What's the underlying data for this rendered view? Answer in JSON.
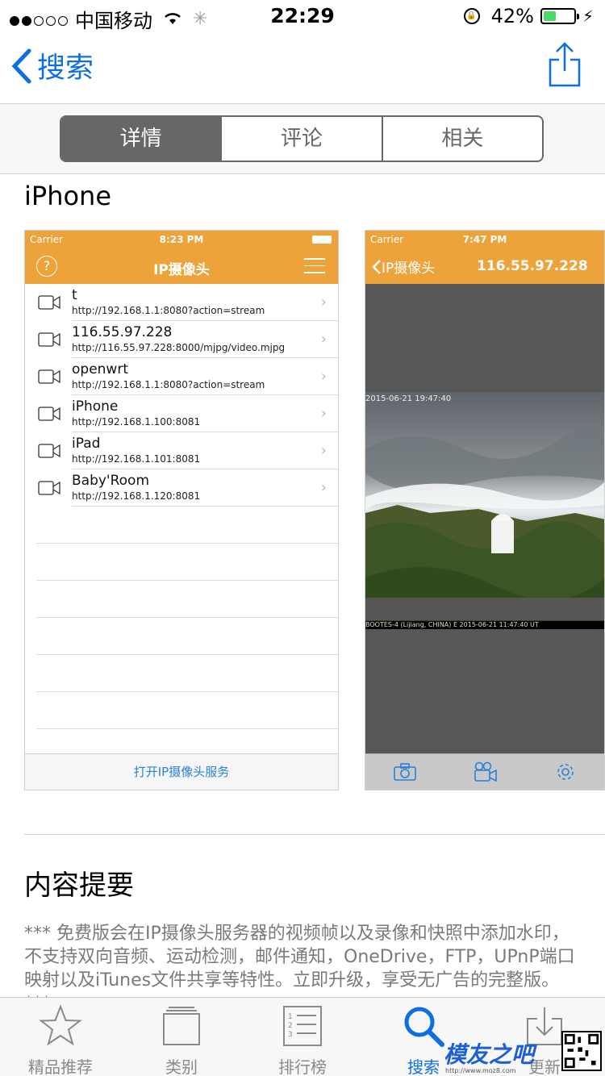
{
  "status_bar": {
    "carrier": "中国移动",
    "time": "22:29",
    "battery": "42%",
    "battery_level": 0.42
  },
  "nav": {
    "back_label": "搜索"
  },
  "segments": [
    {
      "label": "详情",
      "selected": true
    },
    {
      "label": "评论",
      "selected": false
    },
    {
      "label": "相关",
      "selected": false
    }
  ],
  "section_iphone": "iPhone",
  "screenshot1": {
    "carrier": "Carrier",
    "time": "8:23 PM",
    "title": "IP摄像头",
    "rows": [
      {
        "name": "t",
        "url": "http://192.168.1.1:8080?action=stream"
      },
      {
        "name": "116.55.97.228",
        "url": "http://116.55.97.228:8000/mjpg/video.mjpg"
      },
      {
        "name": "openwrt",
        "url": "http://192.168.1.1:8080?action=stream"
      },
      {
        "name": "iPhone",
        "url": "http://192.168.1.100:8081"
      },
      {
        "name": "iPad",
        "url": "http://192.168.1.101:8081"
      },
      {
        "name": "Baby'Room",
        "url": "http://192.168.1.120:8081"
      }
    ],
    "bottom_button": "打开IP摄像头服务"
  },
  "screenshot2": {
    "carrier": "Carrier",
    "time": "7:47 PM",
    "back_label": "IP摄像头",
    "title": "116.55.97.228",
    "stamp_top": "2015-06-21 19:47:40",
    "stamp_bottom": "BOOTES-4 (Lijiang, CHINA) E 2015-06-21 11:47:40 UT"
  },
  "summary": {
    "title": "内容提要",
    "text": "*** 免费版会在IP摄像头服务器的视频帧以及录像和快照中添加水印，不支持双向音频、运动检测，邮件通知，OneDrive，FTP，UPnP端口映射以及iTunes文件共享等特性。立即升级，享受无广告的完整版。***"
  },
  "tabbar": [
    {
      "label": "精品推荐",
      "icon": "star-icon"
    },
    {
      "label": "类别",
      "icon": "categories-icon"
    },
    {
      "label": "排行榜",
      "icon": "top-charts-icon"
    },
    {
      "label": "搜索",
      "icon": "search-icon"
    },
    {
      "label": "更新",
      "icon": "updates-icon"
    }
  ],
  "watermark": {
    "text": "模友之吧",
    "url": "http://www.moz8.com"
  },
  "colors": {
    "ios_blue": "#0e6fe0",
    "app_orange": "#eda23a",
    "segment_gray": "#676767"
  }
}
